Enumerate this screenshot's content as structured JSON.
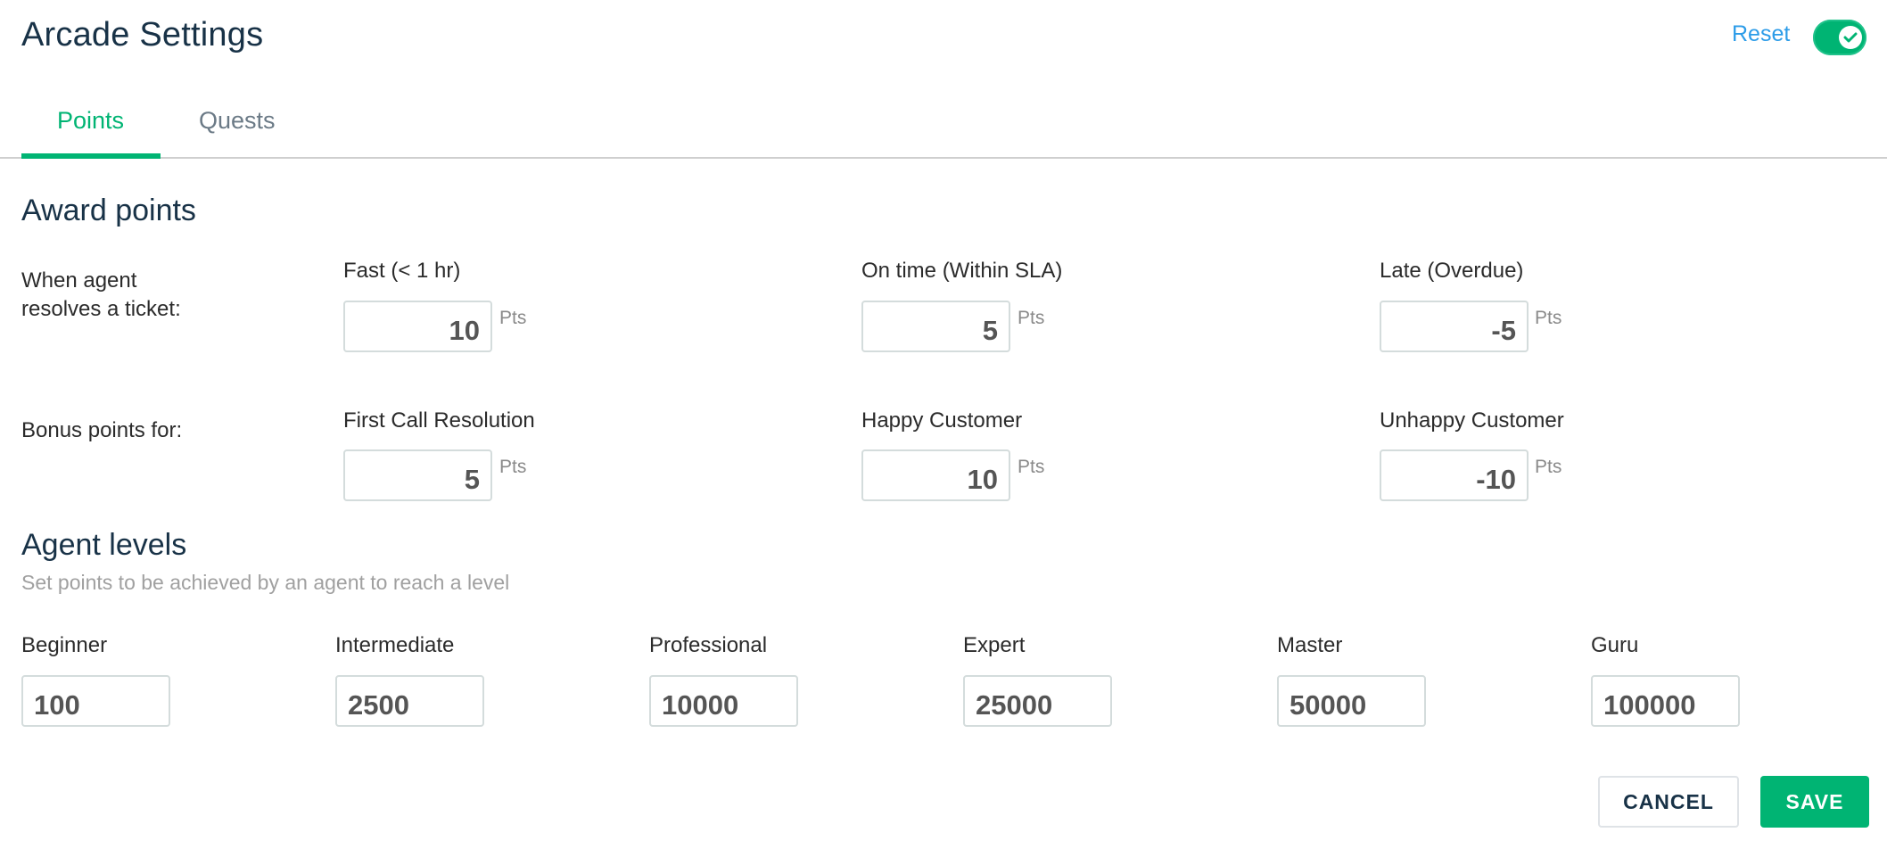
{
  "header": {
    "title": "Arcade Settings",
    "reset_label": "Reset",
    "toggle": {
      "state": "on",
      "icon": "check-icon",
      "color": "#00b473"
    }
  },
  "tabs": [
    {
      "label": "Points",
      "active": true
    },
    {
      "label": "Quests",
      "active": false
    }
  ],
  "award_points": {
    "title": "Award points",
    "unit": "Pts",
    "rows": [
      {
        "label": "When agent\nresolves a ticket:",
        "fields": [
          {
            "label": "Fast (< 1 hr)",
            "value": "10"
          },
          {
            "label": "On time (Within SLA)",
            "value": "5"
          },
          {
            "label": "Late (Overdue)",
            "value": "-5"
          }
        ]
      },
      {
        "label": "Bonus points for:",
        "fields": [
          {
            "label": "First Call Resolution",
            "value": "5"
          },
          {
            "label": "Happy Customer",
            "value": "10"
          },
          {
            "label": "Unhappy Customer",
            "value": "-10"
          }
        ]
      }
    ]
  },
  "agent_levels": {
    "title": "Agent levels",
    "subtitle": "Set points to be achieved by an agent to reach a level",
    "levels": [
      {
        "label": "Beginner",
        "value": "100"
      },
      {
        "label": "Intermediate",
        "value": "2500"
      },
      {
        "label": "Professional",
        "value": "10000"
      },
      {
        "label": "Expert",
        "value": "25000"
      },
      {
        "label": "Master",
        "value": "50000"
      },
      {
        "label": "Guru",
        "value": "100000"
      }
    ]
  },
  "footer": {
    "cancel_label": "CANCEL",
    "save_label": "SAVE"
  },
  "colors": {
    "accent": "#00b473",
    "link": "#2c9ce8",
    "heading": "#183247"
  }
}
